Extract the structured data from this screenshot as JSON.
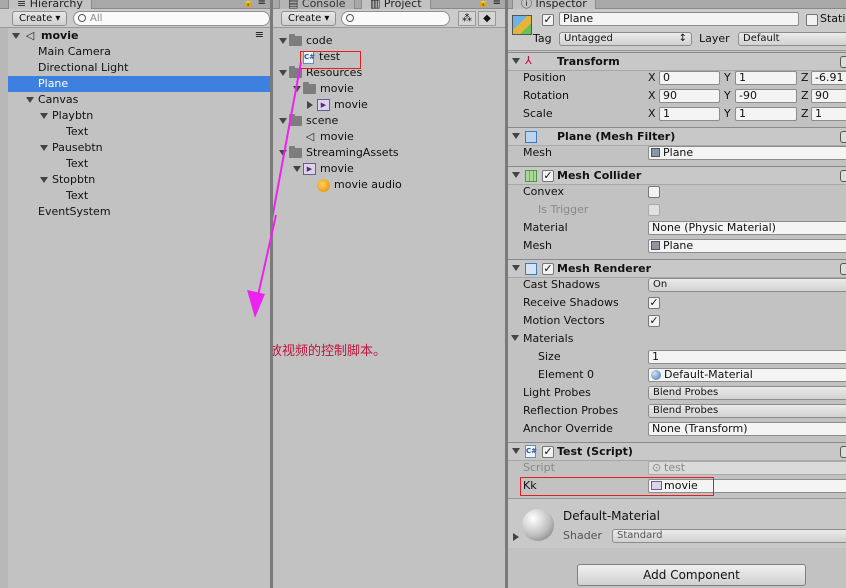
{
  "hierarchy": {
    "tab_label": "Hierarchy",
    "create_label": "Create ▾",
    "search_placeholder": "All",
    "items": [
      {
        "label": "movie",
        "bold": true
      },
      {
        "label": "Main Camera"
      },
      {
        "label": "Directional Light"
      },
      {
        "label": "Plane",
        "selected": true
      },
      {
        "label": "Canvas"
      },
      {
        "label": "Playbtn"
      },
      {
        "label": "Text"
      },
      {
        "label": "Pausebtn"
      },
      {
        "label": "Text"
      },
      {
        "label": "Stopbtn"
      },
      {
        "label": "Text"
      },
      {
        "label": "EventSystem"
      }
    ]
  },
  "project": {
    "tabs": [
      "Console",
      "Project"
    ],
    "create_label": "Create ▾",
    "items": [
      {
        "label": "code",
        "icon": "folder-icon"
      },
      {
        "label": "test",
        "icon": "csharp-script-icon"
      },
      {
        "label": "Resources",
        "icon": "folder-icon"
      },
      {
        "label": "movie",
        "icon": "folder-icon"
      },
      {
        "label": "movie",
        "icon": "video-clip-icon"
      },
      {
        "label": "scene",
        "icon": "folder-icon"
      },
      {
        "label": "movie",
        "icon": "unity-scene-icon"
      },
      {
        "label": "StreamingAssets",
        "icon": "folder-icon"
      },
      {
        "label": "movie",
        "icon": "video-clip-icon"
      },
      {
        "label": "movie audio",
        "icon": "audio-clip-icon"
      }
    ],
    "annotation": "写个播放视频的控制脚本。",
    "annotation_color": "#c0143c",
    "arrow_color": "#ee22ee"
  },
  "inspector": {
    "tab_label": "Inspector",
    "object_name": "Plane",
    "static_label": "Static",
    "tag_label": "Tag",
    "tag_value": "Untagged",
    "layer_label": "Layer",
    "layer_value": "Default",
    "transform": {
      "title": "Transform",
      "position_label": "Position",
      "position": [
        "0",
        "1",
        "-6.91"
      ],
      "rotation_label": "Rotation",
      "rotation": [
        "90",
        "-90",
        "90"
      ],
      "scale_label": "Scale",
      "scale": [
        "1",
        "1",
        "1"
      ],
      "axes": [
        "X",
        "Y",
        "Z"
      ]
    },
    "mesh_filter": {
      "title": "Plane (Mesh Filter)",
      "mesh_label": "Mesh",
      "mesh_value": "Plane"
    },
    "mesh_collider": {
      "title": "Mesh Collider",
      "convex_label": "Convex",
      "is_trigger_label": "Is Trigger",
      "material_label": "Material",
      "material_value": "None (Physic Material)",
      "mesh_label": "Mesh",
      "mesh_value": "Plane"
    },
    "mesh_renderer": {
      "title": "Mesh Renderer",
      "cast_shadows_label": "Cast Shadows",
      "cast_shadows_value": "On",
      "receive_shadows_label": "Receive Shadows",
      "motion_vectors_label": "Motion Vectors",
      "materials_label": "Materials",
      "size_label": "Size",
      "size_value": "1",
      "element0_label": "Element 0",
      "element0_value": "Default-Material",
      "light_probes_label": "Light Probes",
      "light_probes_value": "Blend Probes",
      "reflection_probes_label": "Reflection Probes",
      "reflection_probes_value": "Blend Probes",
      "anchor_override_label": "Anchor Override",
      "anchor_override_value": "None (Transform)"
    },
    "test_script": {
      "title": "Test (Script)",
      "script_label": "Script",
      "script_value": "test",
      "kk_label": "Kk",
      "kk_value": "movie"
    },
    "material": {
      "name": "Default-Material",
      "shader_label": "Shader",
      "shader_value": "Standard"
    },
    "add_component_label": "Add Component"
  }
}
